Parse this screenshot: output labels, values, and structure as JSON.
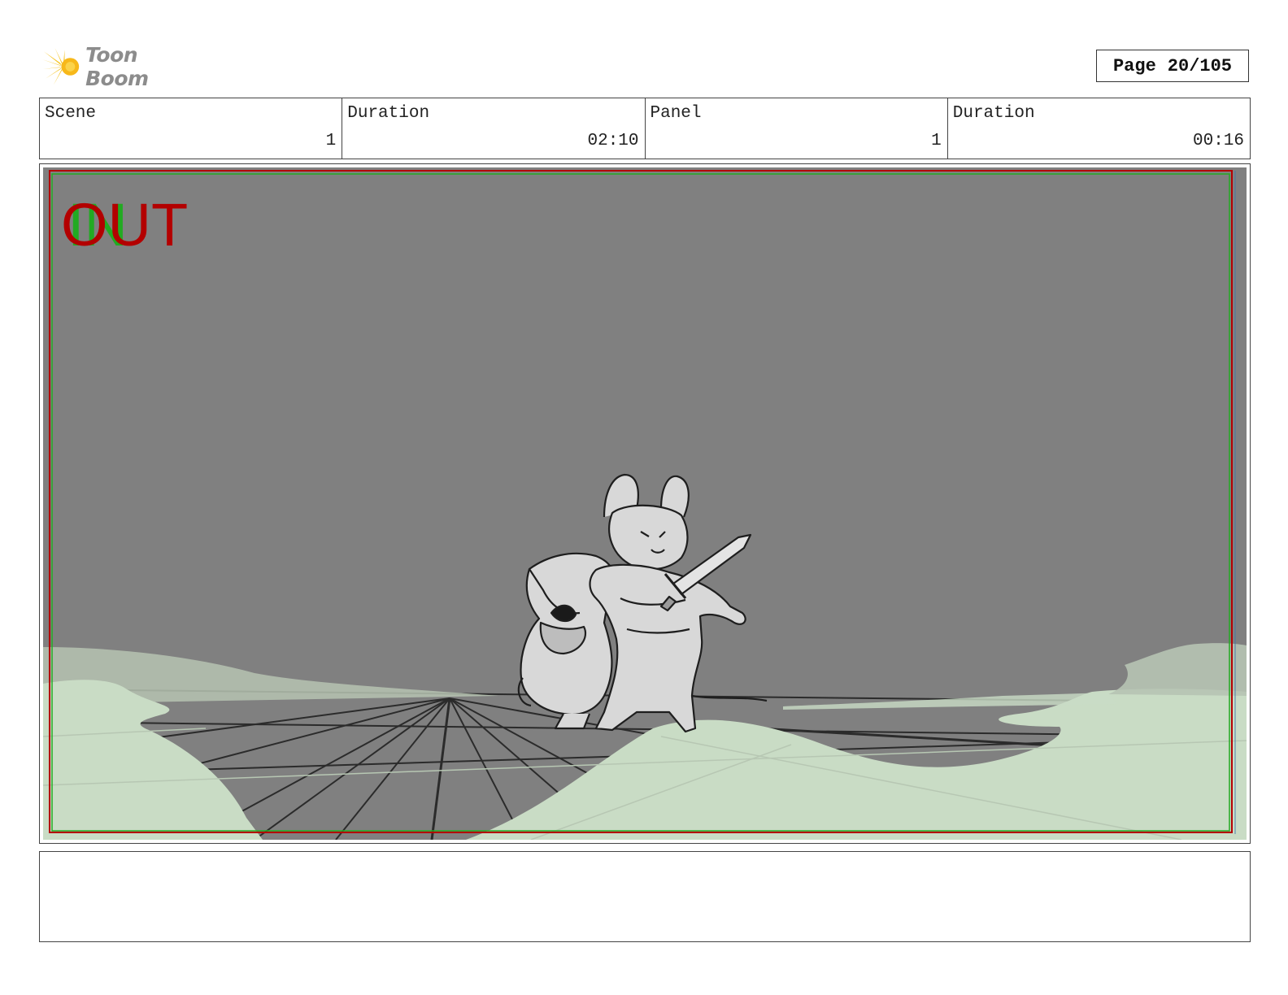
{
  "header": {
    "logo_text": "Toon Boom",
    "page_label": "Page",
    "page_number": "20/105"
  },
  "info": {
    "scene_label": "Scene",
    "scene_value": "1",
    "scene_duration_label": "Duration",
    "scene_duration_value": "02:10",
    "panel_label": "Panel",
    "panel_value": "1",
    "panel_duration_label": "Duration",
    "panel_duration_value": "00:16"
  },
  "panel": {
    "in_label": "IN",
    "out_label": "OUT",
    "colors": {
      "background": "#808080",
      "ground_fill": "#c9dcc5",
      "out_marker": "#b30000",
      "in_marker": "#22aa22",
      "sketch_lines": "#222222",
      "character_fill": "#d8d8d8"
    }
  },
  "caption": {
    "text": ""
  }
}
